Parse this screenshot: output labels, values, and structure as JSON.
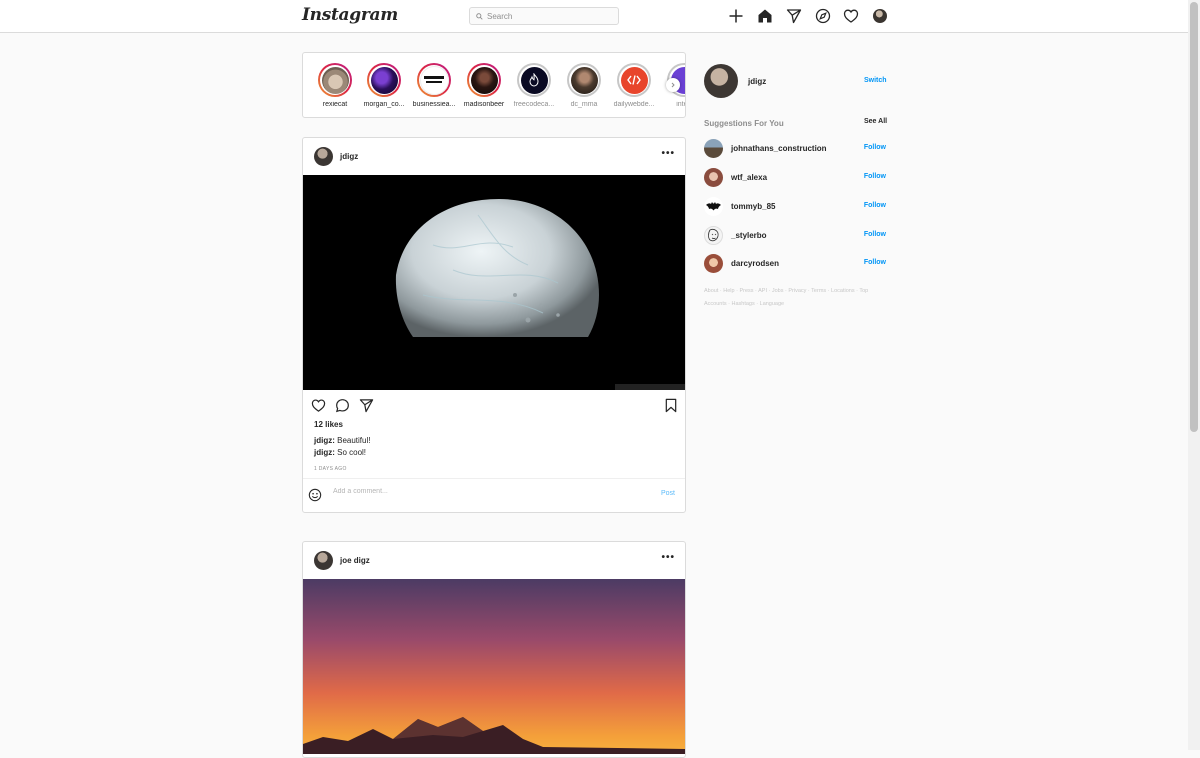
{
  "nav": {
    "logo": "Instagram",
    "search_placeholder": "Search",
    "icons": [
      "new-post-icon",
      "home-icon",
      "direct-icon",
      "explore-icon",
      "activity-heart-icon",
      "profile-avatar"
    ]
  },
  "stories": {
    "items": [
      {
        "username": "rexiecat",
        "seen": false
      },
      {
        "username": "morgan_co...",
        "seen": false
      },
      {
        "username": "businessiea...",
        "seen": false
      },
      {
        "username": "madisonbeer",
        "seen": false
      },
      {
        "username": "freecodeca...",
        "seen": true
      },
      {
        "username": "dc_mma",
        "seen": true
      },
      {
        "username": "dailywebde...",
        "seen": true
      },
      {
        "username": "interf",
        "seen": true
      }
    ]
  },
  "posts": [
    {
      "username": "jdigz",
      "likes": "12 likes",
      "comments": [
        {
          "user": "jdigz:",
          "text": " Beautiful!"
        },
        {
          "user": "jdigz:",
          "text": " So cool!"
        }
      ],
      "timestamp": "1 DAYS AGO",
      "comment_placeholder": "Add a comment...",
      "post_label": "Post"
    },
    {
      "username": "joe digz"
    }
  ],
  "sidebar": {
    "username": "jdigz",
    "switch_label": "Switch",
    "suggestions_title": "Suggestions For You",
    "see_all_label": "See All",
    "suggestions": [
      {
        "username": "johnathans_construction",
        "follow": "Follow"
      },
      {
        "username": "wtf_alexa",
        "follow": "Follow"
      },
      {
        "username": "tommyb_85",
        "follow": "Follow"
      },
      {
        "username": "_stylerbo",
        "follow": "Follow"
      },
      {
        "username": "darcyrodsen",
        "follow": "Follow"
      }
    ],
    "footer_line1": "About · Help · Press · API · Jobs · Privacy · Terms · Locations · Top",
    "footer_line2": "Accounts · Hashtags · Language"
  },
  "colors": {
    "accent_blue": "#0095f6",
    "border": "#dbdbdb",
    "background": "#fafafa",
    "story_gradient": [
      "#f09433",
      "#dc2743",
      "#bc1888"
    ]
  }
}
